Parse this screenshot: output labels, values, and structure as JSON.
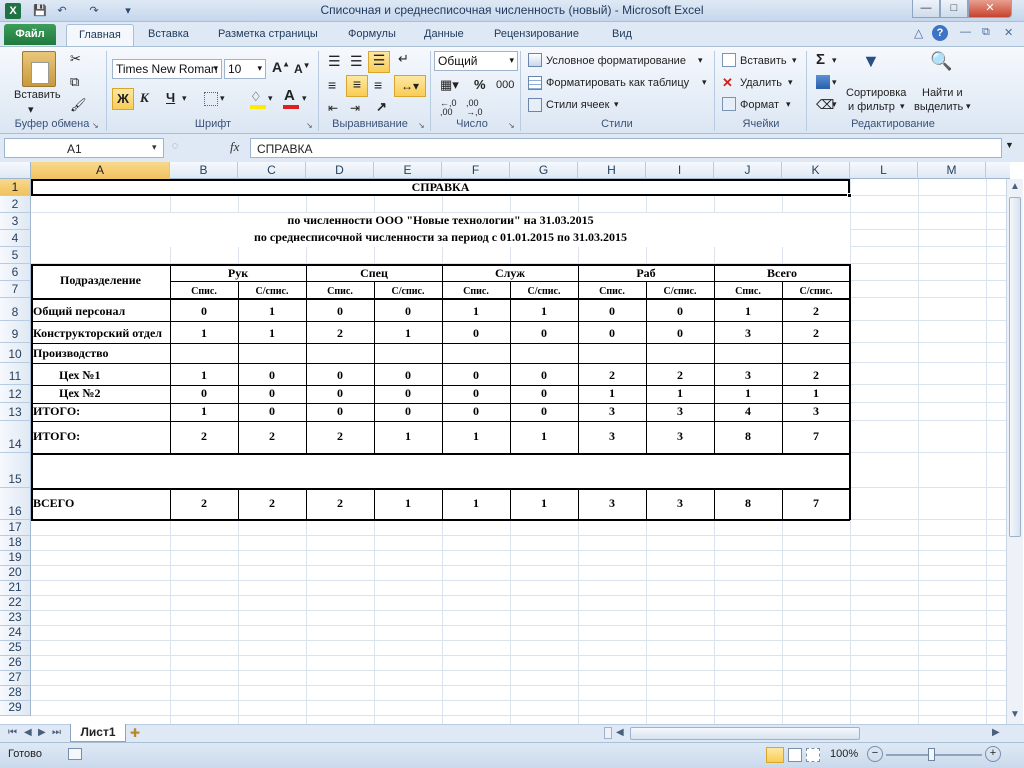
{
  "window": {
    "title": "Списочная и среднесписочная численность (новый)  -  Microsoft Excel"
  },
  "tabs": [
    {
      "label": "Файл"
    },
    {
      "label": "Главная"
    },
    {
      "label": "Вставка"
    },
    {
      "label": "Разметка страницы"
    },
    {
      "label": "Формулы"
    },
    {
      "label": "Данные"
    },
    {
      "label": "Рецензирование"
    },
    {
      "label": "Вид"
    }
  ],
  "ribbon": {
    "clipboard": {
      "paste": "Вставить",
      "label": "Буфер обмена"
    },
    "font": {
      "name": "Times New Roman",
      "size": "10",
      "bold": "Ж",
      "italic": "К",
      "underline": "Ч",
      "label": "Шрифт"
    },
    "alignment": {
      "label": "Выравнивание"
    },
    "number": {
      "format": "Общий",
      "label": "Число",
      "percent": "%",
      "thousands": "000"
    },
    "styles": {
      "conditional": "Условное форматирование",
      "table": "Форматировать как таблицу",
      "cell_styles": "Стили ячеек",
      "label": "Стили"
    },
    "cells": {
      "insert": "Вставить",
      "delete": "Удалить",
      "format": "Формат",
      "label": "Ячейки"
    },
    "editing": {
      "sort": "Сортировка",
      "sort2": "и фильтр",
      "find": "Найти и",
      "find2": "выделить",
      "label": "Редактирование"
    }
  },
  "formula_bar": {
    "name_box": "A1",
    "fx": "fx",
    "value": "СПРАВКА"
  },
  "columns": [
    "A",
    "B",
    "C",
    "D",
    "E",
    "F",
    "G",
    "H",
    "I",
    "J",
    "K",
    "L",
    "M"
  ],
  "rows": [
    "1",
    "2",
    "3",
    "4",
    "5",
    "6",
    "7",
    "8",
    "9",
    "10",
    "11",
    "12",
    "13",
    "14",
    "15",
    "16",
    "17",
    "18",
    "19",
    "20",
    "21",
    "22",
    "23",
    "24",
    "25",
    "26",
    "27",
    "28",
    "29"
  ],
  "sheet": {
    "title": "СПРАВКА",
    "line1": "по численности ООО \"Новые технологии\" на 31.03.2015",
    "line2": "по среднесписочной численности за период с 01.01.2015 по 31.03.2015",
    "header": {
      "dept": "Подразделение",
      "groups": [
        "Рук",
        "Спец",
        "Служ",
        "Раб",
        "Всего"
      ],
      "sub_a": "Спис.",
      "sub_b": "С/спис."
    },
    "data_rows": [
      {
        "label": "Общий персонал",
        "values": [
          "0",
          "1",
          "0",
          "0",
          "1",
          "1",
          "0",
          "0",
          "1",
          "2"
        ]
      },
      {
        "label": "Конструкторский отдел",
        "values": [
          "1",
          "1",
          "2",
          "1",
          "0",
          "0",
          "0",
          "0",
          "3",
          "2"
        ]
      },
      {
        "label": "Производство",
        "values": [
          "",
          "",
          "",
          "",
          "",
          "",
          "",
          "",
          "",
          ""
        ]
      },
      {
        "label": "Цех №1",
        "values": [
          "1",
          "0",
          "0",
          "0",
          "0",
          "0",
          "2",
          "2",
          "3",
          "2"
        ]
      },
      {
        "label": "Цех №2",
        "values": [
          "0",
          "0",
          "0",
          "0",
          "0",
          "0",
          "1",
          "1",
          "1",
          "1"
        ]
      },
      {
        "label": "ИТОГО:",
        "values": [
          "1",
          "0",
          "0",
          "0",
          "0",
          "0",
          "3",
          "3",
          "4",
          "3"
        ]
      },
      {
        "label": "ИТОГО:",
        "values": [
          "2",
          "2",
          "2",
          "1",
          "1",
          "1",
          "3",
          "3",
          "8",
          "7"
        ]
      },
      {
        "label": "",
        "values": [
          "",
          "",
          "",
          "",
          "",
          "",
          "",
          "",
          "",
          ""
        ]
      },
      {
        "label": "ВСЕГО",
        "values": [
          "2",
          "2",
          "2",
          "1",
          "1",
          "1",
          "3",
          "3",
          "8",
          "7"
        ]
      }
    ]
  },
  "sheet_tabs": [
    {
      "label": "Лист1"
    }
  ],
  "status": {
    "ready": "Готово",
    "zoom": "100%"
  }
}
